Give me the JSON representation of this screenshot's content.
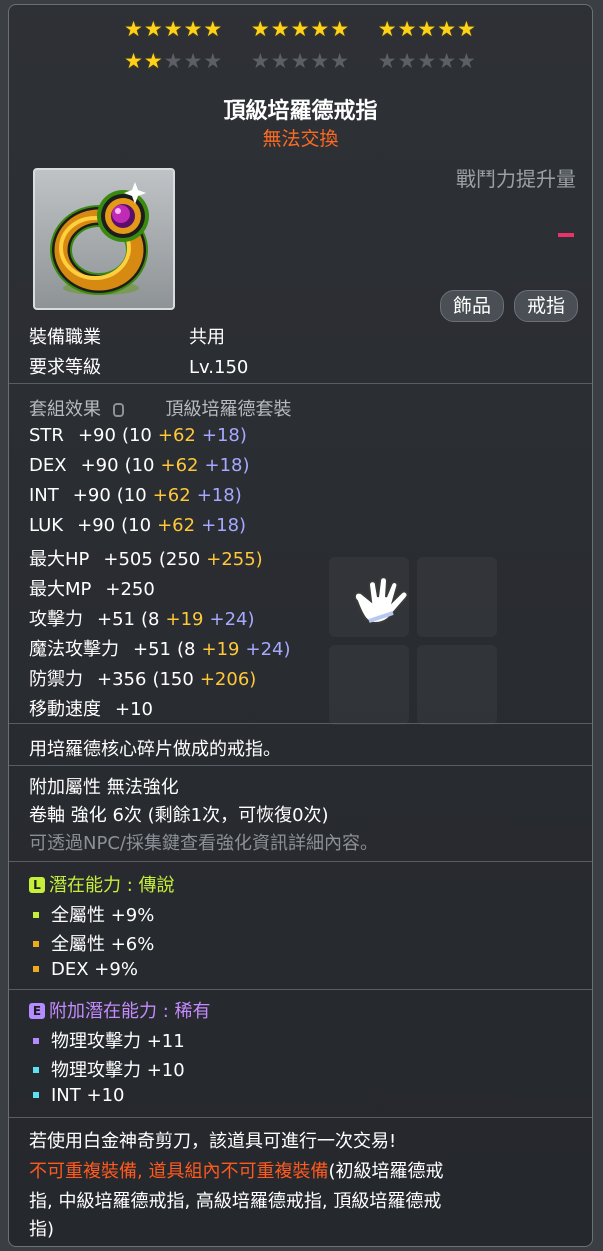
{
  "stars": {
    "row1": [
      "★★★★★",
      "★★★★★",
      "★★★★★"
    ],
    "row2_filled": "★★",
    "row2_empty": "★★★",
    "row2_groups": [
      "★★★★★",
      "★★★★★"
    ]
  },
  "item": {
    "name": "頂級培羅德戒指",
    "trade_status": "無法交換",
    "power_label": "戰鬥力提升量",
    "categories": [
      "飾品",
      "戒指"
    ]
  },
  "requirements": [
    {
      "label": "裝備職業",
      "value": "共用"
    },
    {
      "label": "要求等級",
      "value": "Lv.150"
    }
  ],
  "set": {
    "label": "套組效果",
    "value": "頂級培羅德套裝"
  },
  "stats": [
    {
      "name": "STR",
      "total": "+90",
      "base": "(10",
      "bonus1": "+62",
      "bonus2": "+18)"
    },
    {
      "name": "DEX",
      "total": "+90",
      "base": "(10",
      "bonus1": "+62",
      "bonus2": "+18)"
    },
    {
      "name": "INT",
      "total": "+90",
      "base": "(10",
      "bonus1": "+62",
      "bonus2": "+18)"
    },
    {
      "name": "LUK",
      "total": "+90",
      "base": "(10",
      "bonus1": "+62",
      "bonus2": "+18)"
    },
    {
      "name": "最大HP",
      "total": "+505",
      "base": "(250",
      "bonus1": "+255)",
      "bonus2": ""
    },
    {
      "name": "最大MP",
      "total": "+250",
      "base": "",
      "bonus1": "",
      "bonus2": ""
    },
    {
      "name": "攻擊力",
      "total": "+51",
      "base": "(8",
      "bonus1": "+19",
      "bonus2": "+24)"
    },
    {
      "name": "魔法攻擊力",
      "total": "+51",
      "base": "(8",
      "bonus1": "+19",
      "bonus2": "+24)"
    },
    {
      "name": "防禦力",
      "total": "+356",
      "base": "(150",
      "bonus1": "+206)",
      "bonus2": ""
    },
    {
      "name": "移動速度",
      "total": "+10",
      "base": "",
      "bonus1": "",
      "bonus2": ""
    }
  ],
  "description": "用培羅德核心碎片做成的戒指。",
  "extra": {
    "attr": "附加屬性 無法強化",
    "scroll": "卷軸 強化 6次 (剩餘1次，可恢復0次)",
    "hint": "可透過NPC/採集鍵查看強化資訊詳細內容。"
  },
  "potential": {
    "badge": "L",
    "title": "潛在能力 : 傳說",
    "lines": [
      "全屬性 +9%",
      "全屬性 +6%",
      "DEX +9%"
    ],
    "colors": [
      "#c6ef3a",
      "#f0a81e",
      "#f0a81e"
    ]
  },
  "bonus_potential": {
    "badge": "E",
    "title": "附加潛在能力 : 稀有",
    "lines": [
      "物理攻擊力 +11",
      "物理攻擊力 +10",
      "INT +10"
    ],
    "colors": [
      "#b48cff",
      "#5fe0f0",
      "#5fe0f0"
    ]
  },
  "footer": {
    "line1": "若使用白金神奇剪刀，該道具可進行一次交易!",
    "warn": "不可重複裝備, 道具組內不可重複裝備",
    "line2_rest": "(初級培羅德戒",
    "line3": "指, 中級培羅德戒指, 高級培羅德戒指, 頂級培羅德戒",
    "line4": "指)"
  }
}
